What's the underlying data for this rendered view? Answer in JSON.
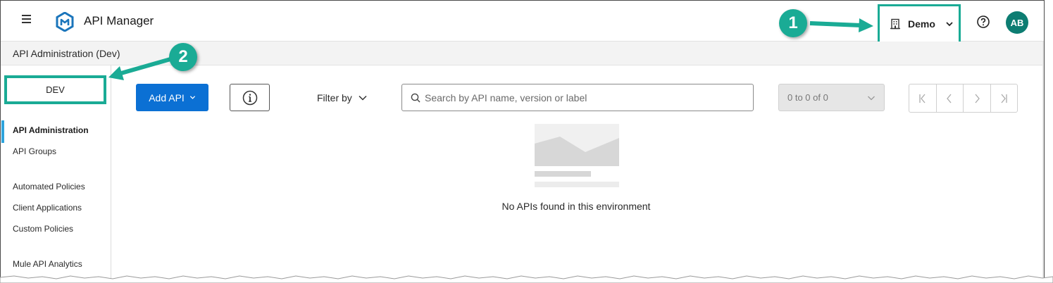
{
  "header": {
    "app_title": "API Manager",
    "menu_icon": "hamburger-menu-icon",
    "logo_icon": "mulesoft-logo-icon",
    "business_group": "Demo",
    "help_icon": "help-icon",
    "avatar_initials": "AB",
    "avatar_color": "#0d7d72"
  },
  "subheader": {
    "breadcrumb": "API Administration (Dev)"
  },
  "sidebar": {
    "environment": "DEV",
    "items": [
      {
        "label": "API Administration",
        "active": true
      },
      {
        "label": "API Groups"
      },
      {
        "label": "Automated Policies"
      },
      {
        "label": "Client Applications"
      },
      {
        "label": "Custom Policies"
      },
      {
        "label": "Mule API Analytics"
      }
    ]
  },
  "toolbar": {
    "add_api_label": "Add API",
    "filter_label": "Filter by",
    "search_placeholder": "Search by API name, version or label",
    "range_label": "0 to 0 of 0"
  },
  "empty_state": {
    "message": "No APIs found in this environment"
  },
  "annotations": {
    "callout_1": "1",
    "callout_2": "2",
    "accent_color": "#1aab95"
  },
  "colors": {
    "primary_button": "#0b70d4",
    "active_indicator": "#2ea3dc"
  }
}
